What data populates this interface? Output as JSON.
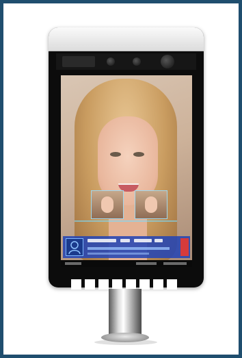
{
  "image": {
    "subject": "face-recognition-terminal",
    "frame_color": "#1f4e6e",
    "background": "#ffffff"
  },
  "device": {
    "cap_color": "#eeeeee",
    "body_color": "#0c0c0c",
    "screen": {
      "info_panel_color": "#2646b4",
      "status_tag_color": "#d63b3b"
    },
    "key_count": 8
  }
}
